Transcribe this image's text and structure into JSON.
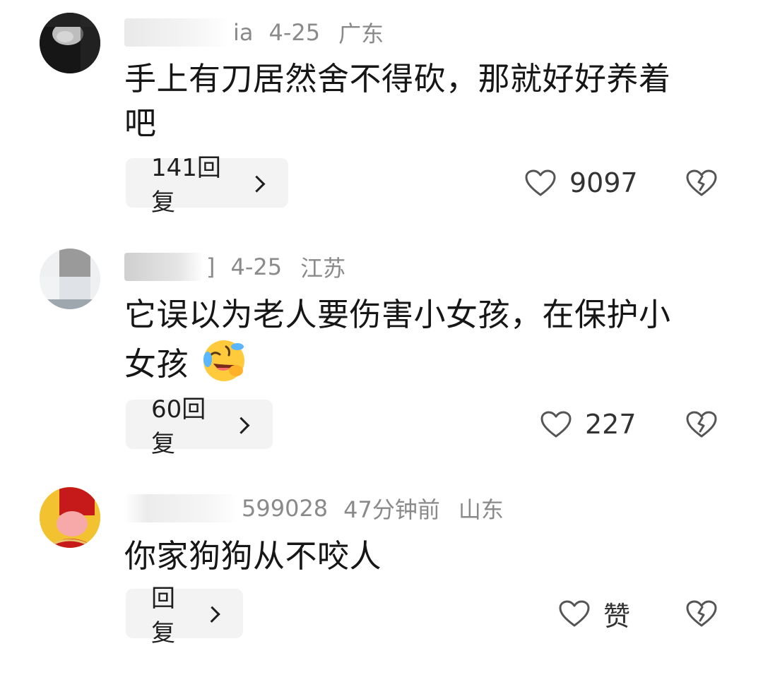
{
  "comments": [
    {
      "username_fragment": "ia",
      "date": "4-25",
      "location": "广东",
      "text_lines": [
        "手上有刀居然舍不得砍，那就好好养着",
        "吧"
      ],
      "reply_label": "141回复",
      "like_count": "9097"
    },
    {
      "username_fragment": "]",
      "date": "4-25",
      "location": "江苏",
      "text_lines": [
        "它误以为老人要伤害小女孩，在保护小",
        "女孩"
      ],
      "emoji": "rolling-on-floor-laughing",
      "reply_label": "60回复",
      "like_count": "227"
    },
    {
      "username_fragment": "599028",
      "date": "47分钟前",
      "location": "山东",
      "text_lines": [
        "你家狗狗从不咬人"
      ],
      "reply_label": "回复",
      "like_count": "赞"
    }
  ],
  "colors": {
    "meta_text": "#8a8a8a",
    "body_text": "#161616",
    "reply_bg": "#f3f3f3",
    "icon_stroke": "#555555"
  },
  "icons": {
    "like": "heart-outline-icon",
    "dislike": "broken-heart-icon",
    "reply_arrow": "chevron-right-icon"
  }
}
